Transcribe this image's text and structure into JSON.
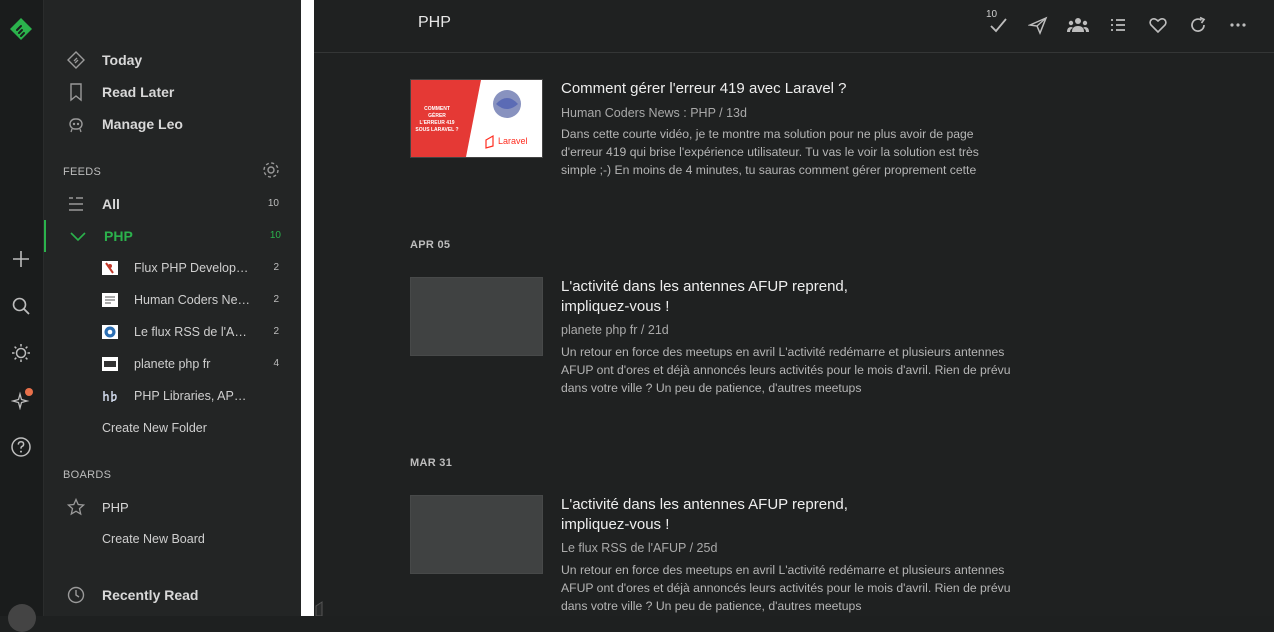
{
  "rail": {
    "icons": [
      "feedly-logo-icon",
      "plus-icon",
      "search-icon",
      "theme-icon",
      "leo-sparkle-icon",
      "help-icon"
    ]
  },
  "sidebar": {
    "nav": [
      {
        "label": "Today",
        "icon": "today-icon"
      },
      {
        "label": "Read Later",
        "icon": "bookmark-icon"
      },
      {
        "label": "Manage Leo",
        "icon": "leo-icon"
      }
    ],
    "feeds_title": "FEEDS",
    "feeds": [
      {
        "label": "All",
        "count": "10",
        "icon": "list-icon"
      },
      {
        "label": "PHP",
        "count": "10",
        "icon": "chevron-down-icon"
      }
    ],
    "subfeeds": [
      {
        "label": "Flux PHP Develop…",
        "count": "2"
      },
      {
        "label": "Human Coders Ne…",
        "count": "2"
      },
      {
        "label": "Le flux RSS de l'A…",
        "count": "2"
      },
      {
        "label": "planete php fr",
        "count": "4"
      },
      {
        "label": "PHP Libraries, AP…",
        "count": ""
      }
    ],
    "create_folder": "Create New Folder",
    "boards_title": "BOARDS",
    "boards": [
      {
        "label": "PHP",
        "icon": "star-icon"
      }
    ],
    "create_board": "Create New Board",
    "recently_read": "Recently Read"
  },
  "topbar": {
    "title": "PHP",
    "badge": "10",
    "buttons": [
      "mark-read-icon",
      "send-icon",
      "team-icon",
      "list-view-icon",
      "heart-icon",
      "refresh-icon",
      "more-icon"
    ]
  },
  "articles": [
    {
      "title": "Comment gérer l'erreur 419 avec Laravel ?",
      "meta": "Human Coders News : PHP / 13d",
      "body": "Dans cette courte vidéo, je te montre ma solution pour ne plus avoir de page d'erreur 419 qui brise l'expérience utilisateur. Tu vas le voir la solution est très simple ;-) En moins de 4 minutes, tu sauras comment gérer proprement cette",
      "thumb": {
        "text": "COMMENT GÉRER L'ERREUR 419 SOUS LARAVEL ?",
        "brand": "Laravel"
      }
    },
    {
      "date": "APR 05",
      "title": "L'activité dans les antennes AFUP reprend, impliquez-vous !",
      "meta": "planete php fr / 21d",
      "body": "Un retour en force des meetups en avril L'activité redémarre et plusieurs antennes AFUP ont d'ores et déjà annoncés leurs activités pour le mois d'avril. Rien de prévu dans votre ville ? Un peu de patience, d'autres meetups"
    },
    {
      "date": "MAR 31",
      "title": "L'activité dans les antennes AFUP reprend, impliquez-vous !",
      "meta": "Le flux RSS de l'AFUP / 25d",
      "body": "Un retour en force des meetups en avril L'activité redémarre et plusieurs antennes AFUP ont d'ores et déjà annoncés leurs activités pour le mois d'avril. Rien de prévu dans votre ville ? Un peu de patience, d'autres meetups"
    }
  ],
  "colors": {
    "accent": "#2bb24c",
    "notify": "#e8704a",
    "bg": "#1f2121"
  }
}
